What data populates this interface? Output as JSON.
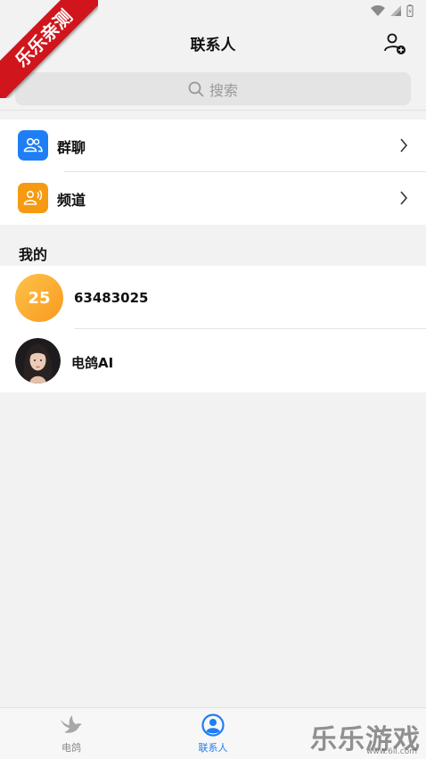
{
  "badge": {
    "text": "乐乐亲测"
  },
  "header": {
    "title": "联系人"
  },
  "search": {
    "placeholder": "搜索"
  },
  "groups": [
    {
      "label": "群聊",
      "color": "#1e7ef5"
    },
    {
      "label": "频道",
      "color": "#f59a11"
    }
  ],
  "mine": {
    "title": "我的"
  },
  "contacts": [
    {
      "avatar_text": "25",
      "name": "63483025"
    },
    {
      "name": "电鸽AI"
    }
  ],
  "tabs": [
    {
      "label": "电鸽",
      "active": false
    },
    {
      "label": "联系人",
      "active": true
    }
  ],
  "watermark": {
    "text": "乐乐游戏",
    "url": "www.6ll.com"
  },
  "colors": {
    "accent": "#1e7ef5",
    "inactive": "#9a9a9a"
  }
}
